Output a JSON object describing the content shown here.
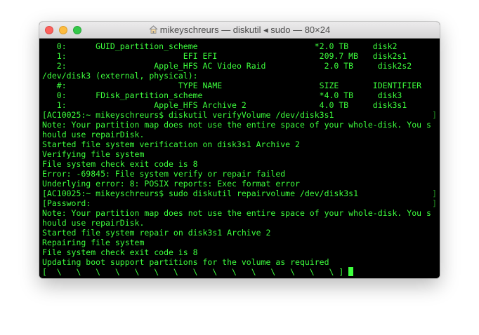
{
  "window": {
    "title": "mikeyschreurs — diskutil ◂ sudo — 80×24",
    "title_icon": "home-folder-icon",
    "traffic_lights": {
      "close": "#fc615d",
      "minimize": "#fdbc40",
      "maximize": "#34c84a"
    }
  },
  "terminal": {
    "background": "#000000",
    "foreground": "#3dff3d",
    "lines": [
      "   0:      GUID_partition_scheme                        *2.0 TB     disk2",
      "   1:                        EFI EFI                     209.7 MB   disk2s1",
      "   2:                  Apple_HFS AC Video Raid            2.0 TB     disk2s2",
      "/dev/disk3 (external, physical):",
      "   #:                       TYPE NAME                    SIZE       IDENTIFIER",
      "   0:      FDisk_partition_scheme                        *4.0 TB     disk3",
      "   1:                  Apple_HFS Archive 2               4.0 TB     disk3s1",
      "[AC10025:~ mikeyschreurs$ diskutil verifyVolume /dev/disk3s1",
      "Note: Your partition map does not use the entire space of your whole-disk. You s",
      "hould use repairDisk.",
      "Started file system verification on disk3s1 Archive 2",
      "Verifying file system",
      "File system check exit code is 8",
      "Error: -69845: File system verify or repair failed",
      "Underlying error: 8: POSIX reports: Exec format error",
      "[AC10025:~ mikeyschreurs$ sudo diskutil repairvolume /dev/disk3s1",
      "[Password:",
      "Note: Your partition map does not use the entire space of your whole-disk. You s",
      "hould use repairDisk.",
      "Started file system repair on disk3s1 Archive 2",
      "Repairing file system",
      "File system check exit code is 8",
      "Updating boot support partitions for the volume as required",
      "[  \\   \\   \\   \\   \\   \\   \\   \\   \\   \\   \\   \\   \\   \\   \\ ] "
    ],
    "right_marks": {
      "7": "]",
      "15": "]",
      "16": "]"
    }
  }
}
